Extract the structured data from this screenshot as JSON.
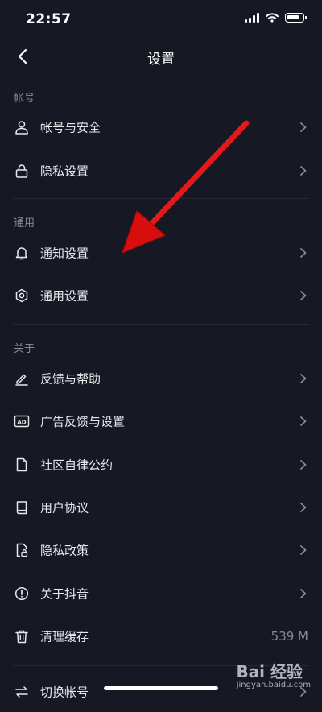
{
  "status": {
    "time": "22:57"
  },
  "nav": {
    "title": "设置"
  },
  "sections": [
    {
      "title": "帐号",
      "items": [
        {
          "label": "帐号与安全",
          "icon": "user-icon"
        },
        {
          "label": "隐私设置",
          "icon": "lock-icon"
        }
      ]
    },
    {
      "title": "通用",
      "items": [
        {
          "label": "通知设置",
          "icon": "bell-icon"
        },
        {
          "label": "通用设置",
          "icon": "gear-icon"
        }
      ]
    },
    {
      "title": "关于",
      "items": [
        {
          "label": "反馈与帮助",
          "icon": "edit-icon"
        },
        {
          "label": "广告反馈与设置",
          "icon": "ad-icon"
        },
        {
          "label": "社区自律公约",
          "icon": "document-icon"
        },
        {
          "label": "用户协议",
          "icon": "book-icon"
        },
        {
          "label": "隐私政策",
          "icon": "privacy-doc-icon"
        },
        {
          "label": "关于抖音",
          "icon": "info-icon"
        },
        {
          "label": "清理缓存",
          "icon": "trash-icon",
          "value": "539 M"
        },
        {
          "label": "切换帐号",
          "icon": "switch-icon"
        }
      ]
    }
  ],
  "watermark": {
    "brand": "Bai 经验",
    "url": "jingyan.baidu.com"
  },
  "colors": {
    "background": "#161823",
    "annotation_arrow": "#e01010"
  }
}
